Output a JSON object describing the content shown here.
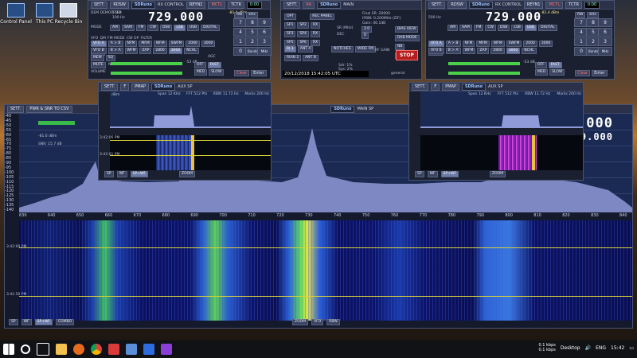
{
  "desktop": {
    "icons": [
      {
        "label": "Control Panel"
      },
      {
        "label": "This PC"
      },
      {
        "label": "Recycle Bin"
      }
    ]
  },
  "left_panel": {
    "tabs": [
      "SETT.",
      "RDSW",
      "SDRuno",
      "RX CONTROL",
      "REYN1",
      "MCTL",
      "TCTR",
      "0:00"
    ],
    "demod_label": "DEM  DEMOD 5Hz",
    "step_label": "STEP",
    "step_value": "100 Hz",
    "frequency": "729.000",
    "level": "-81.4 dBm",
    "mode_label": "MODE",
    "modes": [
      "AM",
      "SAM",
      "FM",
      "CW",
      "DSB",
      "LSB",
      "USB",
      "DIGITAL"
    ],
    "vfo_row": [
      "VFO",
      "QM",
      "FM MODE",
      "CW OP",
      "FILTER",
      "RX BW"
    ],
    "buttons_row1": [
      "VFO A",
      "A > B",
      "NFM",
      "MFM",
      "WFM",
      "SWFM",
      "2000",
      "3000",
      "NCHL"
    ],
    "buttons_row2": [
      "VFO B",
      "B > A",
      "WFM",
      "ZAP",
      "2800",
      "3000",
      "NCHL"
    ],
    "buttons_row3": [
      "MEM",
      "SQ"
    ],
    "buttons_row4": [
      "MUTE"
    ],
    "squelch_value": "-53 dB",
    "agc_label": "AGC",
    "agc_buttons": [
      "OFF",
      "FAST"
    ],
    "agc_buttons2": [
      "MED",
      "SLOW"
    ],
    "keypad": [
      "7",
      "8",
      "9",
      "4",
      "5",
      "6",
      "1",
      "2",
      "3",
      "0",
      "Bands",
      "MHz"
    ],
    "clear": "Clear",
    "enter": "Enter",
    "aux": [
      "RW",
      "kHz"
    ],
    "volume_label": "VOLUME",
    "snr_label": "NR"
  },
  "middle_panel": {
    "tabs": [
      "SETT.",
      "RA",
      "SDRuno",
      "MAIN"
    ],
    "buttons_left": [
      "OPT",
      "REC PANEL"
    ],
    "buttons_grid": [
      "SP1",
      "SP2",
      "RX",
      "SP3",
      "SP4",
      "RX",
      "SP5",
      "SP6",
      "RX"
    ],
    "final_sr": "Final SR: 20000",
    "ifbw": "IFBW: 0.200MHz (ZIF)",
    "gain": "Gain: 46.1dB",
    "sr_label": "SR (MHz)",
    "sr_value": "2.0",
    "dec_label": "DEC",
    "dec_value": "0",
    "lo_label": "LO",
    "buttons_right": [
      "BIAS VIEW",
      "DAB MODE",
      "NB",
      "LO LOCK"
    ],
    "rf_gain": "RF GAIN",
    "stop": "STOP",
    "notches": "NOTCHES",
    "wide": "WIDE FM",
    "ri_buttons": [
      "RI 1",
      "ANT A",
      "RIAN 2",
      "ANT B"
    ],
    "sdr_rate": "Sdr: 1%",
    "sys_rate": "Sys: 2%",
    "datetime": "20/12/2018 15:42:05 UTC",
    "profile": "general"
  },
  "right_panel": {
    "tabs": [
      "SETT.",
      "RDSW",
      "SDRuno",
      "RX CONTROL",
      "REYN1",
      "MCTL",
      "TCTR",
      "0:00"
    ],
    "step_value": "500 Hz",
    "frequency": "729.000",
    "level": "-81.4 dBm",
    "modes": [
      "AM",
      "SAM",
      "FM",
      "CW",
      "DSB",
      "LSB",
      "USB",
      "DIGITAL"
    ],
    "buttons_row1": [
      "VFO A",
      "A > B",
      "NFM",
      "MFM",
      "WFM",
      "SWFM",
      "2000",
      "3000",
      "NCHL"
    ],
    "buttons_row2": [
      "VFO B",
      "B > A",
      "WFM",
      "ZAP",
      "2800",
      "3000",
      "NCHL"
    ],
    "squelch_value": "-53 dB",
    "agc_buttons": [
      "OFF",
      "FAST"
    ],
    "agc_buttons2": [
      "MED",
      "SLOW"
    ],
    "keypad": [
      "7",
      "8",
      "9",
      "4",
      "5",
      "6",
      "1",
      "2",
      "3",
      "0",
      "Bands",
      "MHz"
    ],
    "clear": "Clear",
    "enter": "Enter",
    "aux": [
      "RW",
      "kHz"
    ]
  },
  "aux_left": {
    "tabs": [
      "SETT.",
      "F",
      "PMAP",
      "SDRuno",
      "AUX SP"
    ],
    "span": "Span 12 KHz",
    "fft": "FFT 512 Pts",
    "rbw": "RBW 11.72 Hz",
    "marks": "Marks 200 Hz",
    "dbm_label": "dBm",
    "db_ticks": [
      "-30",
      "-40",
      "-50",
      "-60",
      "-70",
      "-80",
      "-90",
      "-100",
      "-110",
      "-120",
      "-130"
    ],
    "x_ticks": [
      "-4000",
      "-2000",
      "0",
      "2000",
      "4000"
    ],
    "times": [
      "3:42:06 PM",
      "3:42:01 PM"
    ],
    "bottom": [
      "SP",
      "WF",
      "SP+WF",
      "ZOOM"
    ]
  },
  "aux_right": {
    "tabs": [
      "SETT.",
      "F",
      "PMAP",
      "SDRuno",
      "AUX SP"
    ],
    "span": "Span 12 KHz",
    "fft": "FFT 512 Pts",
    "rbw": "RBW 11.72 Hz",
    "marks": "Marks 200 Hz",
    "db_ticks": [
      "-30",
      "-40",
      "-50",
      "-60",
      "-70",
      "-80",
      "-90",
      "-100",
      "-110",
      "-120",
      "-130"
    ],
    "x_ticks": [
      "-4000",
      "-2000",
      "0",
      "2000",
      "4000"
    ],
    "bottom": [
      "SP",
      "WF",
      "SP+WF",
      "ZOOM"
    ]
  },
  "main_spectrum": {
    "tabs": [
      "SETT.",
      "PWR & SNR TO CSV",
      "SDRuno",
      "MAIN SP"
    ],
    "snr": "SNR: 15.7 dB",
    "level": "-81.6 dBm",
    "freq_main": "729.000",
    "freq_sub": "739.000",
    "db_ticks": [
      "-40",
      "-45",
      "-50",
      "-55",
      "-60",
      "-65",
      "-70",
      "-75",
      "-80",
      "-85",
      "-90",
      "-95",
      "-100",
      "-105",
      "-110",
      "-115",
      "-120",
      "-125",
      "-130",
      "-135",
      "-140"
    ],
    "x_ticks": [
      "630",
      "640",
      "650",
      "660",
      "670",
      "680",
      "690",
      "700",
      "710",
      "720",
      "730",
      "740",
      "750",
      "760",
      "770",
      "780",
      "790",
      "800",
      "810",
      "820",
      "830",
      "840"
    ],
    "times": [
      "3:42:00 PM",
      "3:41:50 PM"
    ],
    "bottom_left": [
      "SP",
      "WF",
      "SP+WF",
      "COMBO"
    ],
    "bottom_center": [
      "ZOOM",
      "VFO",
      "RBW"
    ]
  },
  "taskbar": {
    "tray_rates": [
      "0.1 kbps",
      "0.1 kbps"
    ],
    "desktop": "Desktop",
    "lang": "ENG",
    "time": "15:42"
  },
  "colors": {
    "accent": "#e8e24a",
    "spectrum_fill": "#8f9ad8",
    "panel_bg": "#1b2030"
  }
}
